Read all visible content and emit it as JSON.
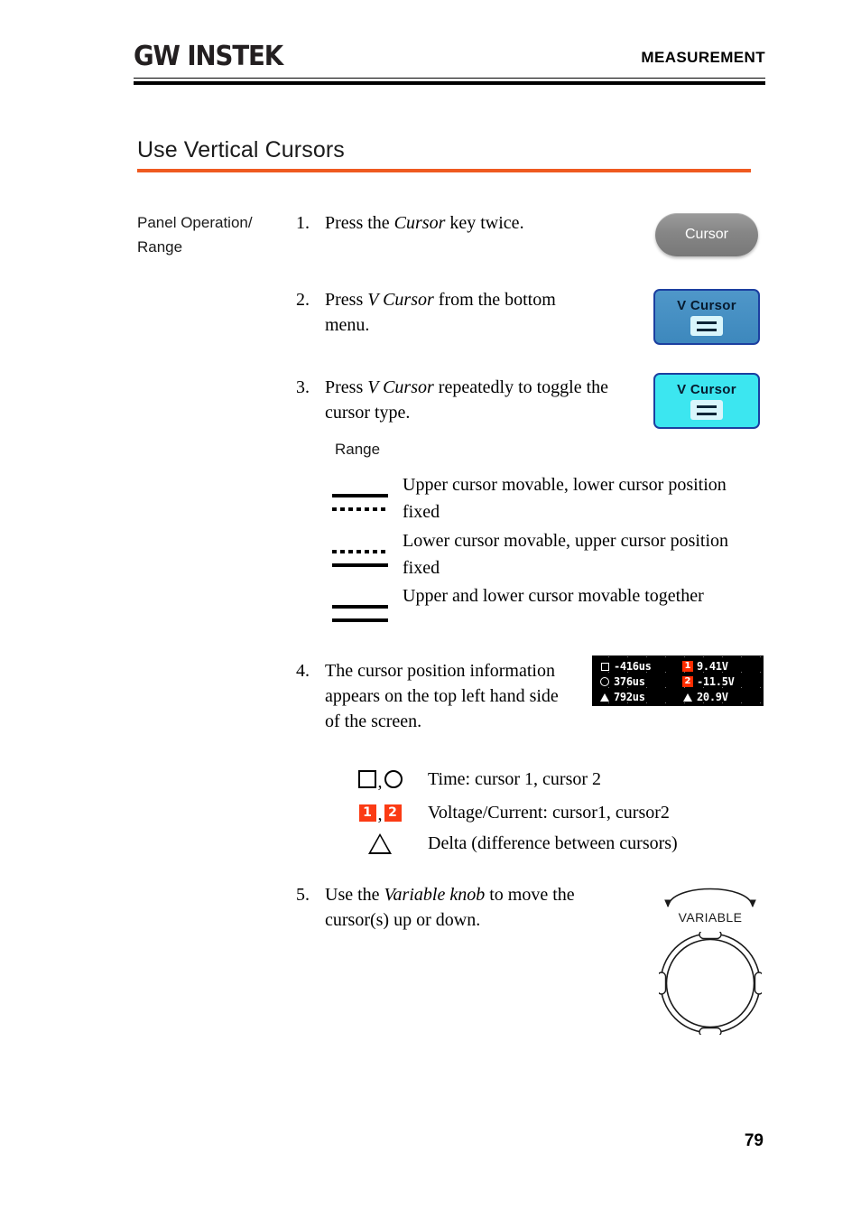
{
  "header": {
    "logo_text": "GW INSTEK",
    "title": "MEASUREMENT"
  },
  "section": {
    "heading": "Use Vertical Cursors",
    "accent_color": "#ef5a20"
  },
  "gutter": {
    "label": "Panel Operation/ Range"
  },
  "steps": [
    {
      "number": "1.",
      "text_html": "Press the <em>Cursor</em> key twice."
    },
    {
      "number": "2.",
      "text_html": "Press <em>V Cursor</em> from the bottom menu."
    },
    {
      "number": "3.",
      "text_html": "Press <em>V Cursor</em> repeatedly to toggle the cursor type."
    },
    {
      "number": "4.",
      "text_html": "The cursor position information appears on the top left hand side of the screen."
    },
    {
      "number": "5.",
      "text_html": "Use the <em>Variable knob</em> to move the cursor(s) up or down."
    }
  ],
  "keys": {
    "cursor_key_label": "Cursor",
    "soft_key_2_label": "V Cursor",
    "soft_key_3_label": "V Cursor"
  },
  "range": {
    "title": "Range",
    "rows": [
      {
        "icon": "solid-over-dashed",
        "top_line": "solid",
        "bottom_line": "dashed",
        "text": "Upper cursor movable, lower cursor position fixed"
      },
      {
        "icon": "dashed-over-solid",
        "top_line": "dashed",
        "bottom_line": "solid",
        "text": "Lower cursor movable, upper cursor position fixed"
      },
      {
        "icon": "solid-over-solid",
        "top_line": "solid",
        "bottom_line": "solid",
        "text": "Upper and lower cursor movable together"
      }
    ]
  },
  "scope_readout": {
    "rows": [
      {
        "left_marker": "square",
        "left_value": "-416us",
        "right_marker": "badge-1",
        "right_value": "9.41V"
      },
      {
        "left_marker": "circle",
        "left_value": "376us",
        "right_marker": "badge-2",
        "right_value": "-11.5V"
      },
      {
        "left_marker": "triangle",
        "left_value": "792us",
        "right_marker": "triangle",
        "right_value": "20.9V"
      }
    ],
    "badge_1_text": "1",
    "badge_2_text": "2",
    "background_color": "#000000",
    "badge_color": "#ff2d00"
  },
  "symbol_legend": [
    {
      "symbols": "square-comma-circle",
      "text": "Time: cursor 1, cursor 2"
    },
    {
      "symbols": "badge1-comma-badge2",
      "badge_1": "1",
      "badge_2": "2",
      "text": "Voltage/Current: cursor1, cursor2"
    },
    {
      "symbols": "triangle",
      "text": "Delta (difference between cursors)"
    }
  ],
  "knob": {
    "caption": "VARIABLE"
  },
  "footer": {
    "page_number": "79"
  }
}
